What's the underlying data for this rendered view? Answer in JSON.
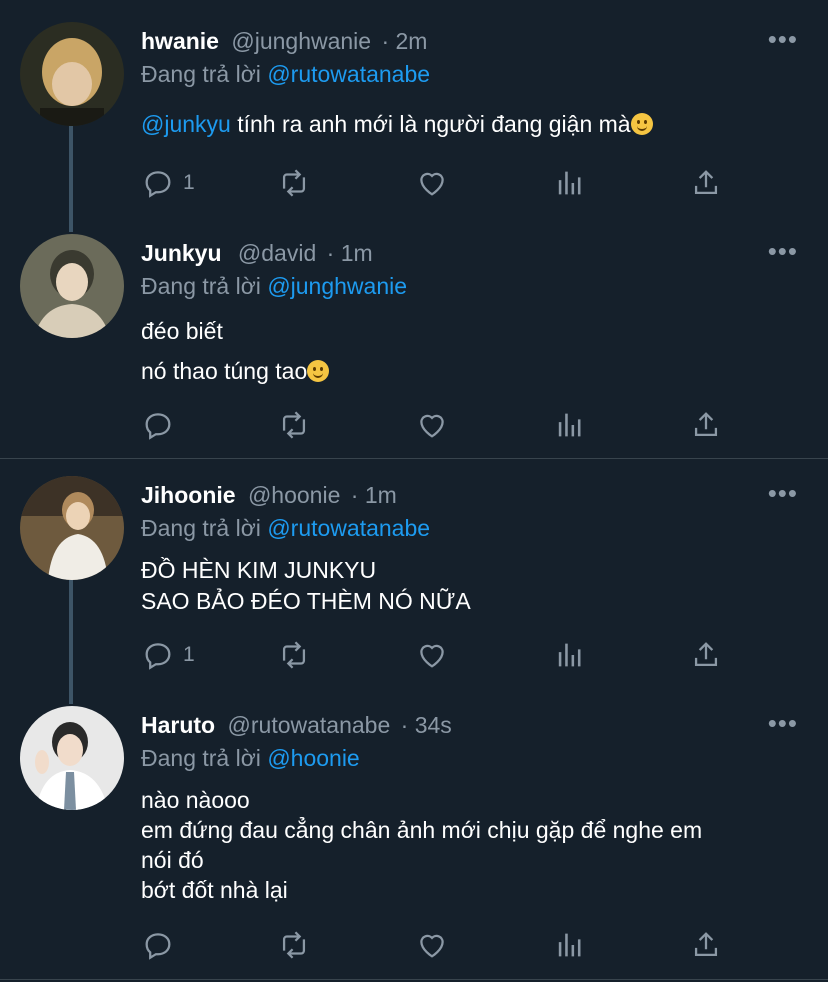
{
  "tweets": [
    {
      "name": "hwanie",
      "handle": "@junghwanie",
      "time": "· 2m",
      "reply_prefix": "Đang trả lời",
      "reply_to": "@rutowatanabe",
      "mention": "@junkyu",
      "lines": [
        "tính ra anh mới là người đang giận mà"
      ],
      "reply_count": "1",
      "avatar_colors": [
        "#2b2d22",
        "#c9a566",
        "#4a4a3a"
      ]
    },
    {
      "name": "Junkyu",
      "handle": "@david",
      "time": "· 1m",
      "reply_prefix": "Đang trả lời",
      "reply_to": "@junghwanie",
      "lines": [
        "đéo biết",
        "nó thao túng tao"
      ],
      "reply_count": "",
      "avatar_colors": [
        "#6b6b5a",
        "#d8cdb8",
        "#3a3a30"
      ]
    },
    {
      "name": "Jihoonie",
      "handle": "@hoonie",
      "time": "· 1m",
      "reply_prefix": "Đang trả lời",
      "reply_to": "@rutowatanabe",
      "lines": [
        "ĐỒ HÈN KIM JUNKYU",
        "SAO BẢO ĐÉO THÈM NÓ NỮA"
      ],
      "reply_count": "1",
      "avatar_colors": [
        "#6e5a3e",
        "#f0ede6",
        "#b08a5c"
      ]
    },
    {
      "name": "Haruto",
      "handle": "@rutowatanabe",
      "time": "· 34s",
      "reply_prefix": "Đang trả lời",
      "reply_to": "@hoonie",
      "lines": [
        "nào nàooo",
        "em đứng đau cẳng chân ảnh mới chịu gặp để nghe em",
        "nói đó",
        "bớt đốt nhà lại"
      ],
      "reply_count": "",
      "avatar_colors": [
        "#e8e8e8",
        "#ffffff",
        "#2a2a2a"
      ]
    }
  ],
  "more_icon": "more-icon",
  "colors": {
    "background": "#15202b",
    "accent": "#1d9bf0",
    "muted": "#8b98a5"
  }
}
